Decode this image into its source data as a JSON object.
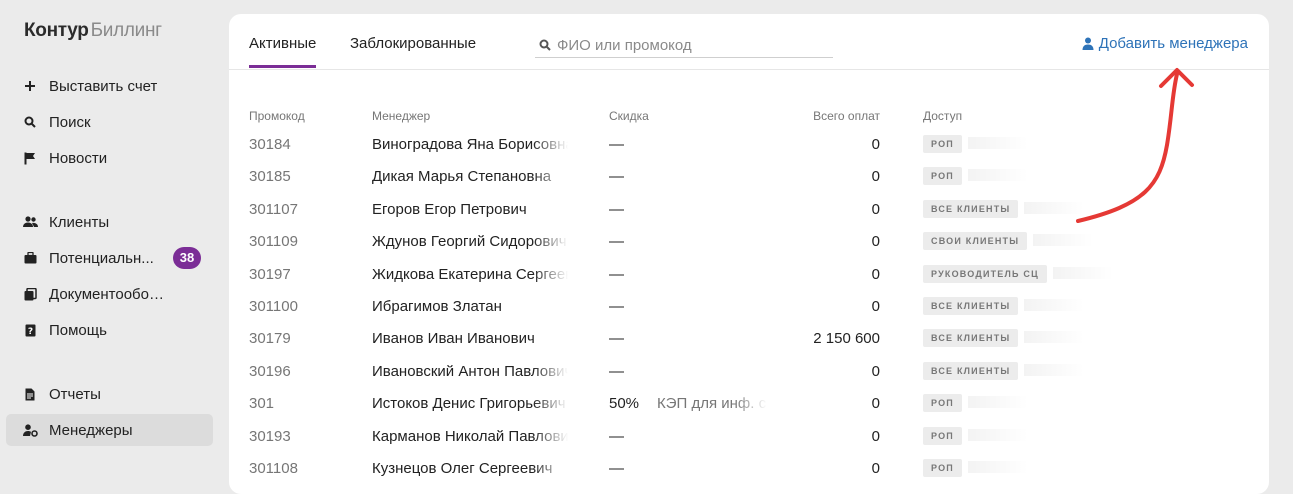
{
  "logo": {
    "brand": "Контур",
    "product": "Биллинг"
  },
  "sidebar": {
    "items": [
      {
        "label": "Выставить счет",
        "icon": "plus-icon"
      },
      {
        "label": "Поиск",
        "icon": "search-icon"
      },
      {
        "label": "Новости",
        "icon": "flag-icon"
      },
      {
        "label": "Клиенты",
        "icon": "users-icon"
      },
      {
        "label": "Потенциальн...",
        "icon": "briefcase-icon",
        "badge": "38"
      },
      {
        "label": "Документооборот",
        "icon": "documents-icon"
      },
      {
        "label": "Помощь",
        "icon": "help-icon"
      },
      {
        "label": "Отчеты",
        "icon": "report-icon"
      },
      {
        "label": "Менеджеры",
        "icon": "user-gear-icon",
        "active": true
      }
    ]
  },
  "tabs": {
    "active": "Активные",
    "blocked": "Заблокированные"
  },
  "search": {
    "placeholder": "ФИО или промокод",
    "value": ""
  },
  "add_manager": {
    "label": "Добавить менеджера",
    "icon": "user-icon"
  },
  "table": {
    "headers": {
      "promo": "Промокод",
      "manager": "Менеджер",
      "discount": "Скидка",
      "payments": "Всего оплат",
      "access": "Доступ"
    },
    "rows": [
      {
        "promo": "30184",
        "manager": "Виноградова Яна Борисовна",
        "discount": "—",
        "note": "",
        "payments": "0",
        "access": "РОП"
      },
      {
        "promo": "30185",
        "manager": "Дикая Марья Степановна",
        "discount": "—",
        "note": "",
        "payments": "0",
        "access": "РОП"
      },
      {
        "promo": "301107",
        "manager": "Егоров Егор Петрович",
        "discount": "—",
        "note": "",
        "payments": "0",
        "access": "ВСЕ КЛИЕНТЫ"
      },
      {
        "promo": "301109",
        "manager": "Ждунов Георгий Сидорович",
        "discount": "—",
        "note": "",
        "payments": "0",
        "access": "СВОИ КЛИЕНТЫ"
      },
      {
        "promo": "30197",
        "manager": "Жидкова Екатерина Сергеевна",
        "discount": "—",
        "note": "",
        "payments": "0",
        "access": "РУКОВОДИТЕЛЬ СЦ"
      },
      {
        "promo": "301100",
        "manager": "Ибрагимов Златан",
        "discount": "—",
        "note": "",
        "payments": "0",
        "access": "ВСЕ КЛИЕНТЫ"
      },
      {
        "promo": "30179",
        "manager": "Иванов Иван Иванович",
        "discount": "—",
        "note": "",
        "payments": "2 150 600",
        "access": "ВСЕ КЛИЕНТЫ"
      },
      {
        "promo": "30196",
        "manager": "Ивановский Антон Павлович",
        "discount": "—",
        "note": "",
        "payments": "0",
        "access": "ВСЕ КЛИЕНТЫ"
      },
      {
        "promo": "301",
        "manager": "Истоков Денис Григорьевич",
        "discount": "50%",
        "note": "КЭП для инф. с",
        "payments": "0",
        "access": "РОП"
      },
      {
        "promo": "30193",
        "manager": "Карманов Николай Павлович",
        "discount": "—",
        "note": "",
        "payments": "0",
        "access": "РОП"
      },
      {
        "promo": "301108",
        "manager": "Кузнецов Олег Сергеевич",
        "discount": "—",
        "note": "",
        "payments": "0",
        "access": "РОП"
      }
    ]
  },
  "colors": {
    "accent": "#7b2d96",
    "link": "#2e73b8",
    "annotation": "#e53935"
  }
}
